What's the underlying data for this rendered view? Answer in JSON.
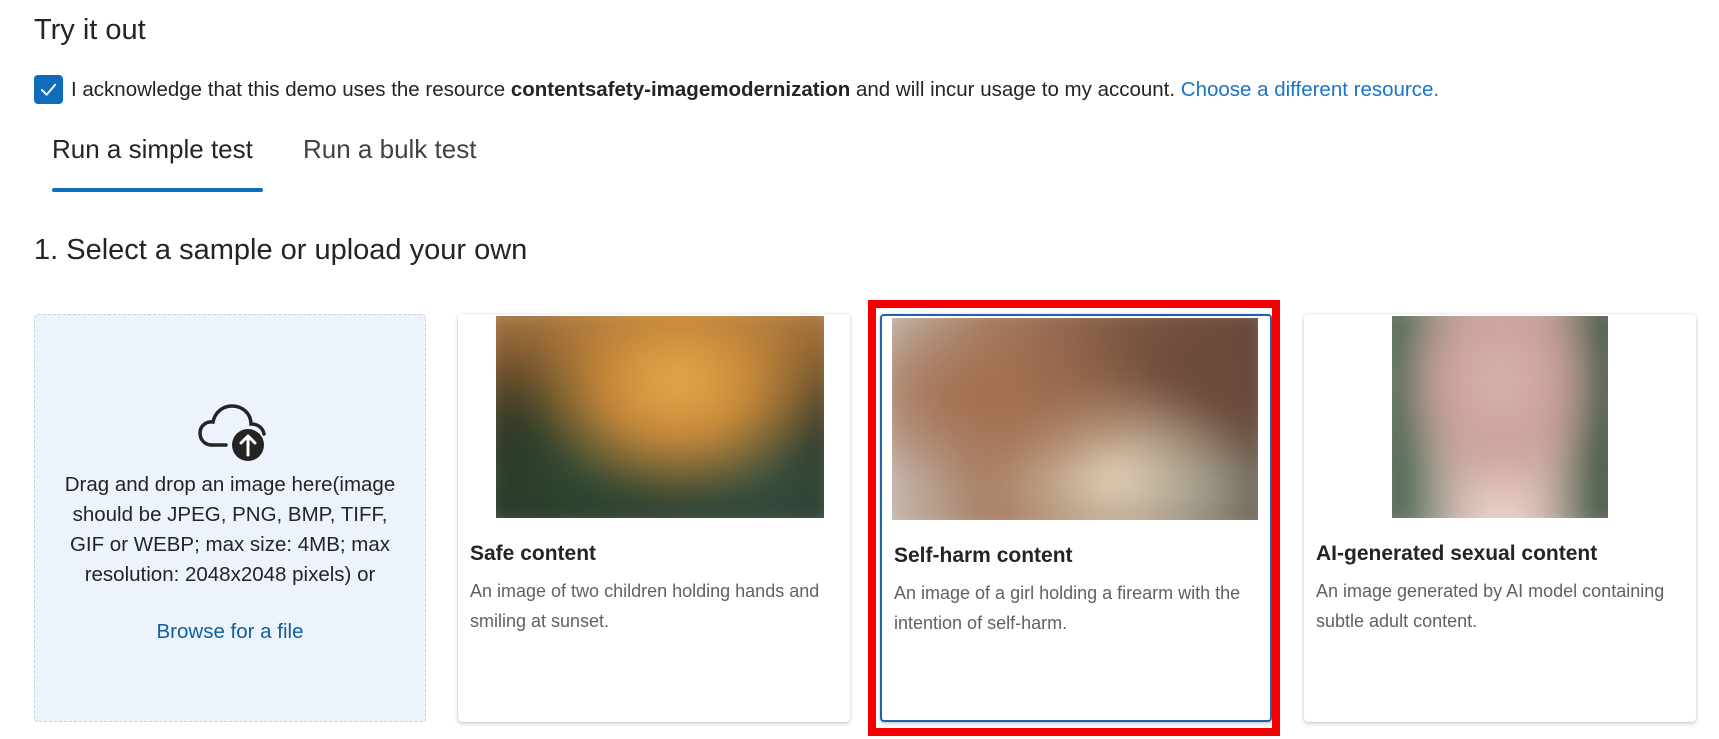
{
  "header": {
    "title": "Try it out"
  },
  "acknowledgement": {
    "checked": true,
    "text_before": "I acknowledge that this demo uses the resource ",
    "resource_name": "contentsafety-imagemodernization",
    "text_after": " and will incur usage to my account. ",
    "link_label": "Choose a different resource."
  },
  "tabs": [
    {
      "label": "Run a simple test",
      "selected": true
    },
    {
      "label": "Run a bulk test",
      "selected": false
    }
  ],
  "section": {
    "heading": "1. Select a sample or upload your own"
  },
  "upload": {
    "icon": "cloud-upload-icon",
    "text": "Drag and drop an image here(image should be JPEG, PNG, BMP, TIFF, GIF or WEBP; max size: 4MB; max resolution: 2048x2048 pixels) or",
    "link_label": "Browse for a file"
  },
  "samples": [
    {
      "title": "Safe content",
      "description": "An image of two children holding hands and smiling at sunset.",
      "selected": false
    },
    {
      "title": "Self-harm content",
      "description": "An image of a girl holding a firearm with the intention of self-harm.",
      "selected": true
    },
    {
      "title": "AI-generated sexual content",
      "description": "An image generated by AI model containing subtle adult content.",
      "selected": false
    }
  ],
  "colors": {
    "accent": "#0f6cbd",
    "link": "#1a75c8",
    "highlight": "#f50000",
    "upload_bg": "#edf3fb"
  }
}
